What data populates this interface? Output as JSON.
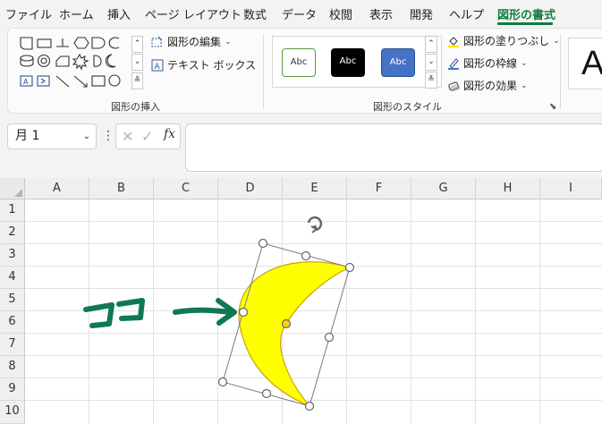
{
  "menu": {
    "items": [
      "ファイル",
      "ホーム",
      "挿入",
      "ページ レイアウト",
      "数式",
      "データ",
      "校閲",
      "表示",
      "開発",
      "ヘルプ",
      "図形の書式"
    ],
    "active_index": 10
  },
  "ribbon": {
    "insert_shapes": {
      "label": "図形の挿入",
      "edit_shape": "図形の編集",
      "text_box": "テキスト ボックス"
    },
    "shape_styles": {
      "label": "図形のスタイル",
      "swatch_text": "Abc",
      "fill": "図形の塗りつぶし",
      "outline": "図形の枠線",
      "effects": "図形の効果"
    },
    "wordart_preview": "A"
  },
  "formula_bar": {
    "name_box": "月 1",
    "fx": "fx",
    "value": ""
  },
  "sheet": {
    "columns": [
      "A",
      "B",
      "C",
      "D",
      "E",
      "F",
      "G",
      "H",
      "I"
    ],
    "rows": [
      "1",
      "2",
      "3",
      "4",
      "5",
      "6",
      "7",
      "8",
      "9",
      "10"
    ]
  },
  "shape": {
    "name": "moon",
    "fill_color": "#ffff00",
    "outline_color": "#c9a400"
  },
  "annotation": {
    "text": "ココ",
    "color": "#0f7a52"
  },
  "colors": {
    "accent": "#107c41",
    "style_outline": "#5b9a3c",
    "style_dark": "#000000",
    "style_blue": "#4472c4"
  }
}
